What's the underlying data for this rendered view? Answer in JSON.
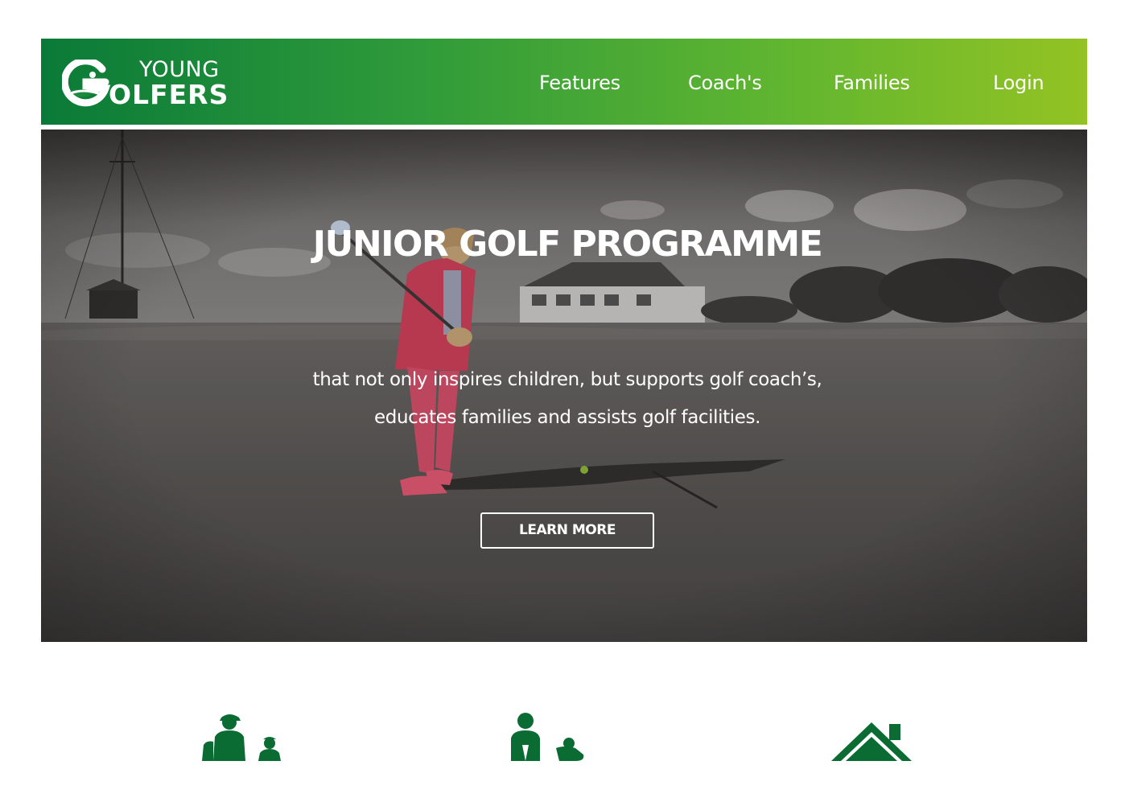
{
  "brand": {
    "logo_word_top": "YOUNG",
    "logo_word_bottom": "OLFERS",
    "primary_green": "#0a7a38",
    "lime_green": "#93c323"
  },
  "nav": {
    "items": [
      {
        "label": "Features"
      },
      {
        "label": "Coach's"
      },
      {
        "label": "Families"
      },
      {
        "label": "Login"
      }
    ]
  },
  "hero": {
    "title": "JUNIOR GOLF PROGRAMME",
    "subtitle_line1": "that not only inspires children, but supports golf coach’s,",
    "subtitle_line2": "educates families and assists golf facilities.",
    "cta_label": "LEARN MORE"
  },
  "features": {
    "icons": [
      "coach-and-child-icon",
      "golfer-and-child-icon",
      "clubhouse-icon"
    ],
    "icon_color": "#0a6b33"
  }
}
